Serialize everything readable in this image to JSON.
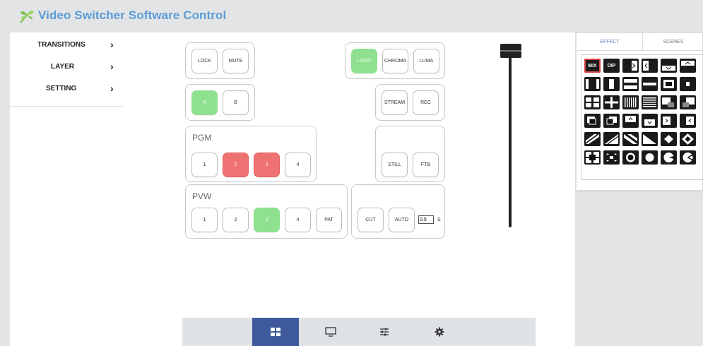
{
  "app": {
    "title": "Video Switcher Software Control",
    "logo_icon": "dragonfly-logo-icon"
  },
  "sidebar": {
    "items": [
      {
        "label": "TRANSITIONS",
        "icon": "chevron-right-icon"
      },
      {
        "label": "LAYER",
        "icon": "chevron-right-icon"
      },
      {
        "label": "SETTING",
        "icon": "chevron-right-icon"
      }
    ]
  },
  "controls": {
    "lock": "LOCK",
    "mute": "MUTE",
    "logo": "LOGO",
    "chroma": "CHROMA",
    "luma": "LUMA",
    "a": "A",
    "b": "B",
    "stream": "STREAM",
    "rec": "REC",
    "still": "STILL",
    "ftb": "FTB",
    "cut": "CUT",
    "auto": "AUTO",
    "duration_value": "0.5",
    "duration_unit": "S"
  },
  "pgm": {
    "title": "PGM",
    "buttons": [
      "1",
      "2",
      "3",
      "4"
    ]
  },
  "pvw": {
    "title": "PVW",
    "buttons": [
      "1",
      "2",
      "3",
      "4",
      "PAT"
    ]
  },
  "effects": {
    "tabs": [
      "EFFECT",
      "SCENES"
    ],
    "active_tab": "EFFECT",
    "labels": {
      "mix": "MIX",
      "dip": "DIP"
    },
    "selected": "MIX"
  },
  "state": {
    "logo_active": true,
    "a_active": true,
    "pgm_active": [
      "2",
      "3"
    ],
    "pvw_active": "3",
    "tbar_position": 0.0
  },
  "bottom_nav": [
    {
      "icon": "grid-icon",
      "active": true
    },
    {
      "icon": "monitor-icon",
      "active": false
    },
    {
      "icon": "sliders-icon",
      "active": false
    },
    {
      "icon": "gear-icon",
      "active": false
    }
  ],
  "colors": {
    "title_blue": "#5b9bd5",
    "active_green": "#8fe08f",
    "program_red": "#ef7272",
    "nav_active": "#3e5a9c"
  }
}
